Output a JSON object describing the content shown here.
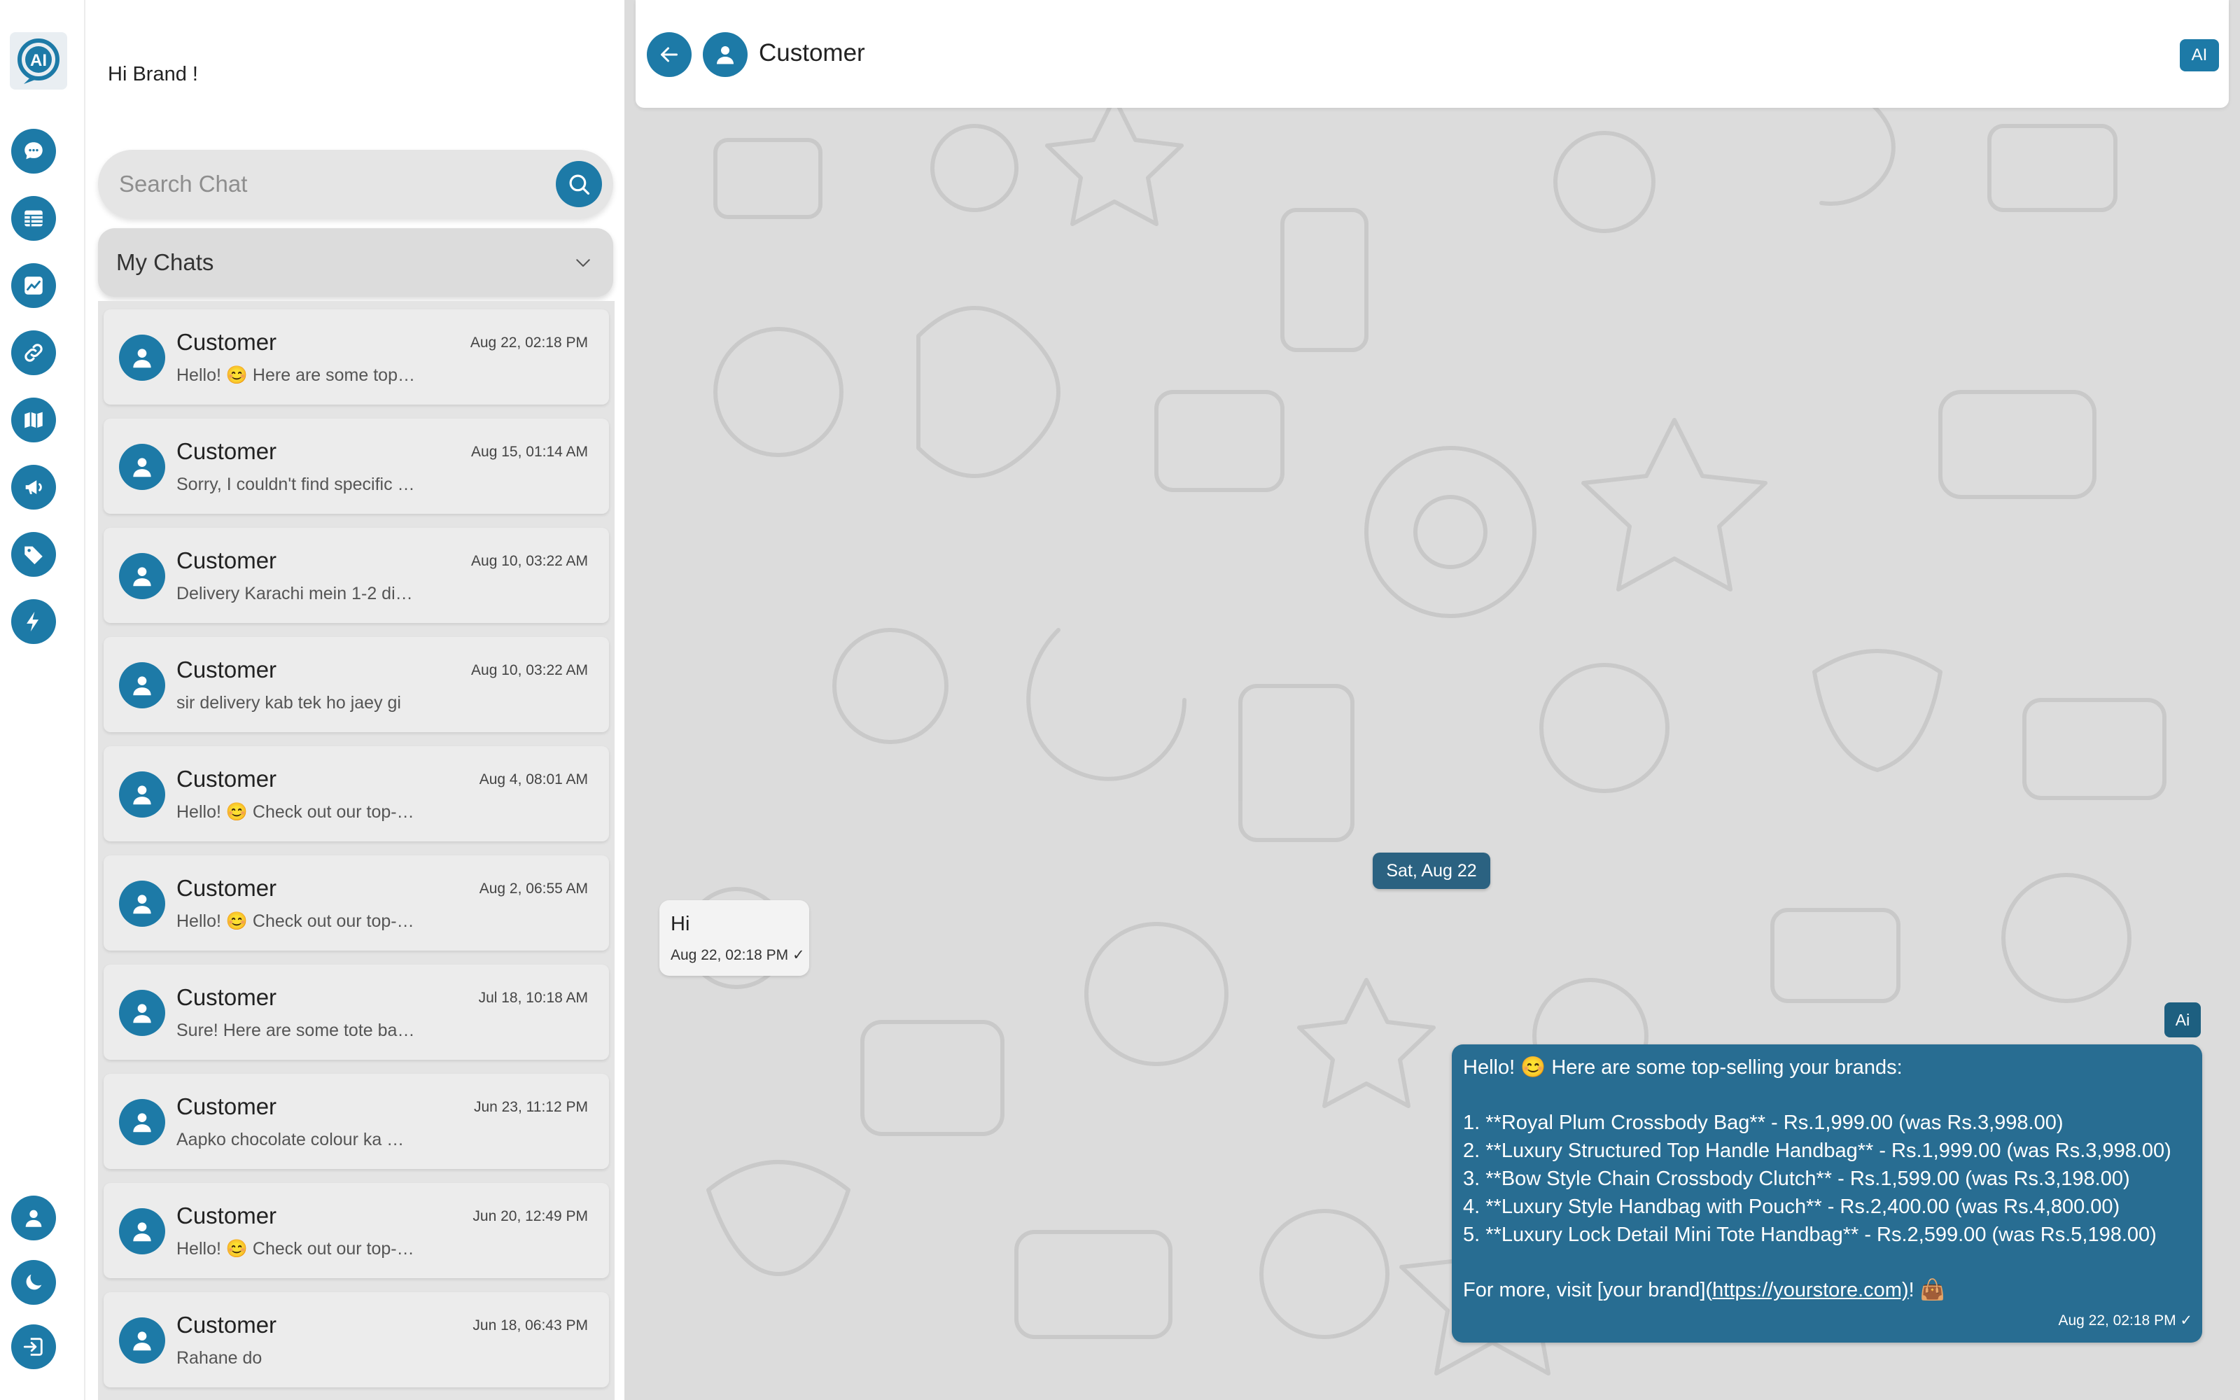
{
  "app": {
    "logo": "ai-chat-logo"
  },
  "rail": {
    "items": [
      {
        "name": "chat",
        "icon": "chat-bubble-icon"
      },
      {
        "name": "table",
        "icon": "table-icon"
      },
      {
        "name": "analytics",
        "icon": "chart-icon"
      },
      {
        "name": "links",
        "icon": "link-icon"
      },
      {
        "name": "map",
        "icon": "map-icon"
      },
      {
        "name": "campaigns",
        "icon": "megaphone-icon"
      },
      {
        "name": "tags",
        "icon": "tag-icon"
      },
      {
        "name": "automation",
        "icon": "lightning-icon"
      }
    ],
    "bottom": [
      {
        "name": "profile",
        "icon": "user-icon"
      },
      {
        "name": "theme",
        "icon": "moon-icon"
      },
      {
        "name": "logout",
        "icon": "logout-icon"
      }
    ]
  },
  "sidebar": {
    "greeting": "Hi Brand !",
    "search_placeholder": "Search Chat",
    "filter_label": "My Chats",
    "chats": [
      {
        "name": "Customer",
        "time": "Aug 22, 02:18 PM",
        "preview": "Hello! 😊  Here are some top…"
      },
      {
        "name": "Customer",
        "time": "Aug 15, 01:14 AM",
        "preview": "Sorry, I couldn't find specific …"
      },
      {
        "name": "Customer",
        "time": "Aug 10, 03:22 AM",
        "preview": "Delivery Karachi mein 1-2 di…"
      },
      {
        "name": "Customer",
        "time": "Aug 10, 03:22 AM",
        "preview": "sir delivery kab tek ho jaey gi"
      },
      {
        "name": "Customer",
        "time": "Aug 4, 08:01 AM",
        "preview": "Hello! 😊  Check out our top-…"
      },
      {
        "name": "Customer",
        "time": "Aug 2, 06:55 AM",
        "preview": "Hello! 😊  Check out our top-…"
      },
      {
        "name": "Customer",
        "time": "Jul 18, 10:18 AM",
        "preview": "Sure! Here are some tote ba…"
      },
      {
        "name": "Customer",
        "time": "Jun 23, 11:12 PM",
        "preview": "Aapko chocolate colour ka …"
      },
      {
        "name": "Customer",
        "time": "Jun 20, 12:49 PM",
        "preview": "Hello! 😊  Check out our top-…"
      },
      {
        "name": "Customer",
        "time": "Jun 18, 06:43 PM",
        "preview": "Rahane do"
      }
    ]
  },
  "conversation": {
    "title": "Customer",
    "ai_toggle": "AI",
    "date_chip": "Sat, Aug 22",
    "incoming": {
      "text": "Hi",
      "time": "Aug 22, 02:18 PM ✓"
    },
    "ai_badge": "Ai",
    "outgoing": {
      "lines": [
        "Hello! 😊  Here are some top-selling your brands:",
        "1. **Royal Plum Crossbody Bag** - Rs.1,999.00 (was Rs.3,998.00)",
        "2. **Luxury Structured Top Handle Handbag** - Rs.1,999.00 (was Rs.3,998.00)",
        "3. **Bow Style Chain Crossbody Clutch** - Rs.1,599.00 (was Rs.3,198.00)",
        "4. **Luxury Style Handbag with Pouch** - Rs.2,400.00 (was Rs.4,800.00)",
        "5. **Luxury Lock Detail Mini Tote Handbag** - Rs.2,599.00 (was Rs.5,198.00)"
      ],
      "footer_prefix": "For more, visit [your brand](",
      "footer_link": "https://yourstore.com)",
      "footer_suffix": "! 👜",
      "time": "Aug 22, 02:18 PM ✓"
    }
  },
  "colors": {
    "accent": "#1d7aa7",
    "bubble_out": "#286d92",
    "date_chip": "#2b6281",
    "canvas": "#dcdcdc"
  }
}
